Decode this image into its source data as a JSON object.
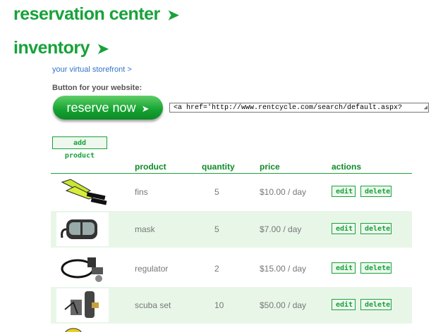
{
  "titles": {
    "reservation": "reservation center",
    "inventory": "inventory",
    "arrow": "➤"
  },
  "storefront_link": "your virtual storefront >",
  "button_label": "Button for your website:",
  "reserve_button": {
    "text": "reserve now",
    "arrow": "➤"
  },
  "embed_code": "<a href='http://www.rentcycle.com/search/default.aspx?",
  "add_product": "add product",
  "table": {
    "headers": [
      "product",
      "quantity",
      "price",
      "actions"
    ],
    "rows": [
      {
        "product": "fins",
        "quantity": "5",
        "price": "$10.00 / day",
        "edit": "edit",
        "delete": "delete"
      },
      {
        "product": "mask",
        "quantity": "5",
        "price": "$7.00 / day",
        "edit": "edit",
        "delete": "delete"
      },
      {
        "product": "regulator",
        "quantity": "2",
        "price": "$15.00 / day",
        "edit": "edit",
        "delete": "delete"
      },
      {
        "product": "scuba set",
        "quantity": "10",
        "price": "$50.00 / day",
        "edit": "edit",
        "delete": "delete"
      }
    ]
  },
  "colors": {
    "brand_green": "#17a23a",
    "row_alt": "#e8f6e8",
    "link_blue": "#2f74c9"
  }
}
